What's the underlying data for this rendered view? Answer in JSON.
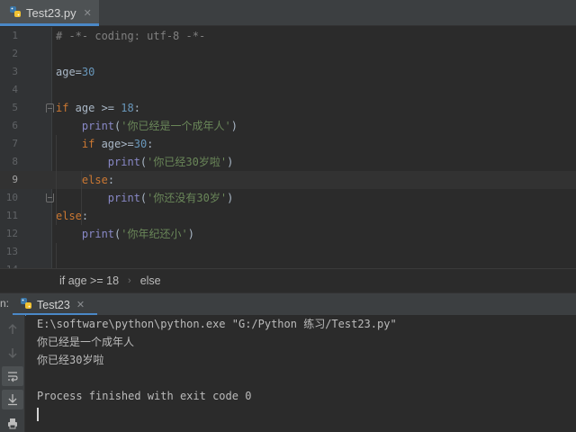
{
  "editor_tab": {
    "label": "Test23.py",
    "close_glyph": "✕"
  },
  "code": {
    "lines": [
      {
        "n": "1",
        "tokens": [
          {
            "t": "# -*- coding: utf-8 -*-",
            "c": "comment"
          }
        ]
      },
      {
        "n": "2",
        "tokens": []
      },
      {
        "n": "3",
        "tokens": [
          {
            "t": "age=",
            "c": "default"
          },
          {
            "t": "30",
            "c": "number"
          }
        ]
      },
      {
        "n": "4",
        "tokens": []
      },
      {
        "n": "5",
        "tokens": [
          {
            "t": "if",
            "c": "keyword"
          },
          {
            "t": " age >= ",
            "c": "default"
          },
          {
            "t": "18",
            "c": "number"
          },
          {
            "t": ":",
            "c": "default"
          }
        ]
      },
      {
        "n": "6",
        "tokens": [
          {
            "t": "    ",
            "c": "default"
          },
          {
            "t": "print",
            "c": "builtin"
          },
          {
            "t": "(",
            "c": "default"
          },
          {
            "t": "'你已经是一个成年人'",
            "c": "string"
          },
          {
            "t": ")",
            "c": "default"
          }
        ]
      },
      {
        "n": "7",
        "tokens": [
          {
            "t": "    ",
            "c": "default"
          },
          {
            "t": "if",
            "c": "keyword"
          },
          {
            "t": " age>=",
            "c": "default"
          },
          {
            "t": "30",
            "c": "number"
          },
          {
            "t": ":",
            "c": "default"
          }
        ]
      },
      {
        "n": "8",
        "tokens": [
          {
            "t": "        ",
            "c": "default"
          },
          {
            "t": "print",
            "c": "builtin"
          },
          {
            "t": "(",
            "c": "default"
          },
          {
            "t": "'你已经30岁啦'",
            "c": "string"
          },
          {
            "t": ")",
            "c": "default"
          }
        ]
      },
      {
        "n": "9",
        "tokens": [
          {
            "t": "    ",
            "c": "default"
          },
          {
            "t": "else",
            "c": "keyword"
          },
          {
            "t": ":",
            "c": "default"
          }
        ]
      },
      {
        "n": "10",
        "tokens": [
          {
            "t": "        ",
            "c": "default"
          },
          {
            "t": "print",
            "c": "builtin"
          },
          {
            "t": "(",
            "c": "default"
          },
          {
            "t": "'你还没有30岁'",
            "c": "string"
          },
          {
            "t": ")",
            "c": "default"
          }
        ]
      },
      {
        "n": "11",
        "tokens": [
          {
            "t": "else",
            "c": "keyword"
          },
          {
            "t": ":",
            "c": "default"
          }
        ]
      },
      {
        "n": "12",
        "tokens": [
          {
            "t": "    ",
            "c": "default"
          },
          {
            "t": "print",
            "c": "builtin"
          },
          {
            "t": "(",
            "c": "default"
          },
          {
            "t": "'你年纪还小'",
            "c": "string"
          },
          {
            "t": ")",
            "c": "default"
          }
        ]
      },
      {
        "n": "13",
        "tokens": []
      },
      {
        "n": "14",
        "tokens": []
      }
    ],
    "current_line": "9"
  },
  "breadcrumb": {
    "items": [
      "if age >= 18",
      "else"
    ],
    "separator": "›"
  },
  "run_panel": {
    "prefix": "n:",
    "tab_label": "Test23",
    "tab_close": "✕",
    "output": [
      "E:\\software\\python\\python.exe \"G:/Python 练习/Test23.py\"",
      "你已经是一个成年人",
      "你已经30岁啦",
      "",
      "Process finished with exit code 0"
    ]
  },
  "toolbar_icons": [
    "arrow-up-icon",
    "arrow-down-icon",
    "soft-wrap-icon",
    "scroll-to-end-icon",
    "print-icon"
  ],
  "colors": {
    "background": "#2b2b2b",
    "keyword": "#cc7832",
    "number": "#6897bb",
    "string": "#6a8759",
    "builtin": "#8888c6",
    "comment": "#808080",
    "accent": "#4a88c7"
  }
}
